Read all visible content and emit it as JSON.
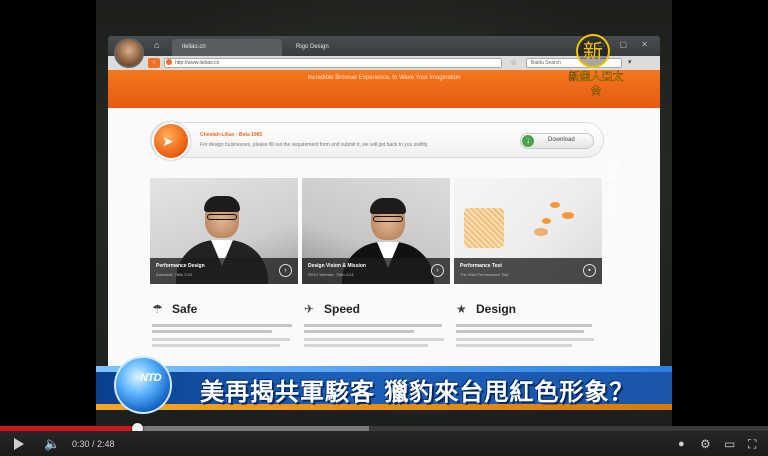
{
  "video": {
    "browser": {
      "tabs": [
        "Ileilao.cn",
        "Rigo Design"
      ],
      "address": "http://www.liebao.cn",
      "search_placeholder": "Baidu Search",
      "banner": "Incredible Browser Experience, to Wave Your Imagination",
      "promo": {
        "title": "Cheetah-Lilian · Beta 1985",
        "description": "For design businesses, please fill out the requirement form and submit it, we will get back to you swiftly.",
        "download_label": "Download"
      },
      "cards": [
        {
          "title": "Performance Design",
          "subtitle": "Kalsoesit, 7Min  3:24"
        },
        {
          "title": "Design Vision & Mission",
          "subtitle": "RIGO Website, 7Min 3:24"
        },
        {
          "title": "Performance Test",
          "subtitle": "The Web Performance Test"
        }
      ],
      "features": [
        {
          "icon": "umbrella-icon",
          "title": "Safe"
        },
        {
          "icon": "rocket-icon",
          "title": "Speed"
        },
        {
          "icon": "star-icon",
          "title": "Design"
        }
      ]
    },
    "watermark": {
      "seal": "新",
      "name": "新唐人亞太台"
    },
    "vertical_text": "翻攝自網路",
    "lower_third": {
      "channel_label": "NTD",
      "headline": "美再揭共軍駭客 獵豹來台甩紅色形象？"
    }
  },
  "controls": {
    "current_time": "0:30",
    "duration": "2:48",
    "time_display": "0:30 / 2:48",
    "played_fraction": 0.178,
    "buffered_fraction": 0.48
  },
  "colors": {
    "progress_played": "#cc181e",
    "brand_orange": "#f36f21",
    "news_blue": "#1a56aa",
    "watermark_gold": "#f2c200"
  }
}
